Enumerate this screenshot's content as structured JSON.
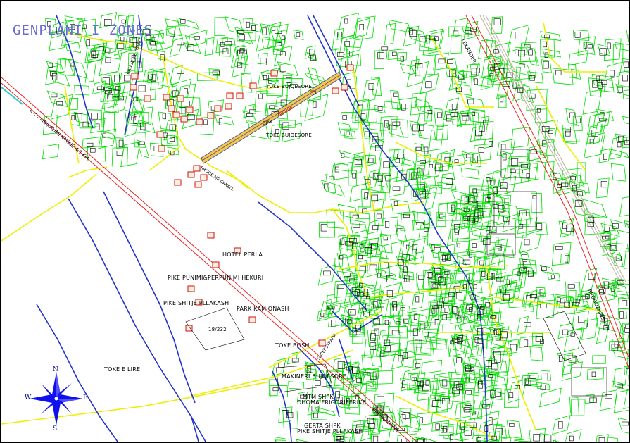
{
  "title": "GENPLANI I ZONES",
  "colors": {
    "background": "#ffffff",
    "buildings": "#00b400",
    "parcels": "#00dd00",
    "roads_main": "#ee2222",
    "roads_secondary": "#2233cc",
    "streets": "#eeee00",
    "railway": "#c8b89a",
    "title": "#6a6ad8",
    "compass": "#1010ee"
  },
  "labels": {
    "toke_bujqesore_1": "TOKE BUJQESORE",
    "toke_bujqesore_2": "TOKE BUJQESORE",
    "hotel": "HOTEL PERLA",
    "pike_punimi": "PIKE PUNIMI&PERPUNIMI HEKURI",
    "pike_shitje": "PIKE SHITJE PLLAKASH",
    "park": "PARK  KAMIONASH",
    "toke_bosh": "TOKE BOSH",
    "plot_number": "18/232",
    "toke_e_lire": "TOKE E LIRE",
    "makineri": "MAKINERI BUJQESORE",
    "mtm": "MTM SHPK",
    "dhoma": "DHOMA FRIGORIFERIKE",
    "gerta": "GERTA SHPK",
    "pike_shitje_2": "PIKE SHITJE PLLAKASH",
    "road_mbikalimi": "<<< MBIKALIMI KAVAJE 4.7 KM",
    "road_rrogozhine": "RROGOZHINE",
    "road_rrogozhine_2": "RROGOZHINE --->",
    "road_lekander": "LEKANDER",
    "road_hotel_caketi": "RRUGE ME CAKELL",
    "road_rruge_me_asfalt": "RRUGE ME ASFALT",
    "road_superstrada": "SUPERSTRADA",
    "road_bujqesore_strip": "RRUGE",
    "road_gjak": "GJAK"
  },
  "compass": {
    "n": "N",
    "s": "S",
    "e": "E",
    "w": "W"
  }
}
